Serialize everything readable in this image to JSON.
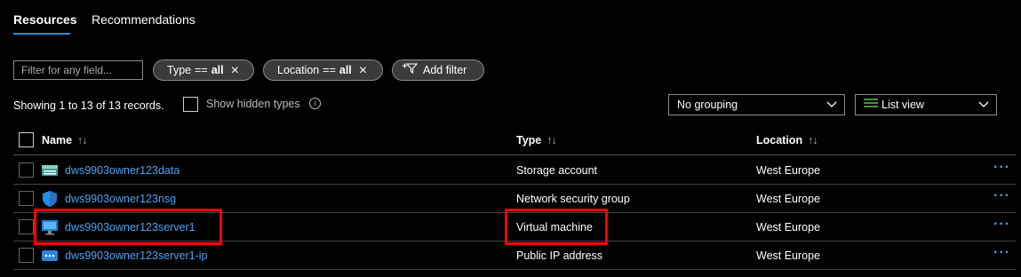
{
  "tabs": [
    {
      "label": "Resources",
      "active": true
    },
    {
      "label": "Recommendations",
      "active": false
    }
  ],
  "filter": {
    "placeholder": "Filter for any field..."
  },
  "pills": {
    "type": {
      "field": "Type",
      "op": "==",
      "value": "all"
    },
    "location": {
      "field": "Location",
      "op": "==",
      "value": "all"
    },
    "add_filter": "Add filter"
  },
  "showing_text": "Showing 1 to 13 of 13 records.",
  "show_hidden_label": "Show hidden types",
  "grouping": {
    "selected": "No grouping"
  },
  "view": {
    "selected": "List view"
  },
  "columns": {
    "name": "Name",
    "type": "Type",
    "location": "Location"
  },
  "rows": [
    {
      "name": "dws9903owner123data",
      "type": "Storage account",
      "location": "West Europe",
      "icon": "storage-account-icon"
    },
    {
      "name": "dws9903owner123nsg",
      "type": "Network security group",
      "location": "West Europe",
      "icon": "network-security-group-icon"
    },
    {
      "name": "dws9903owner123server1",
      "type": "Virtual machine",
      "location": "West Europe",
      "icon": "virtual-machine-icon"
    },
    {
      "name": "dws9903owner123server1-ip",
      "type": "Public IP address",
      "location": "West Europe",
      "icon": "public-ip-icon"
    }
  ],
  "colors": {
    "accent": "#2f8bd8",
    "link": "#4aa3ee",
    "highlight": "#ff0000"
  }
}
